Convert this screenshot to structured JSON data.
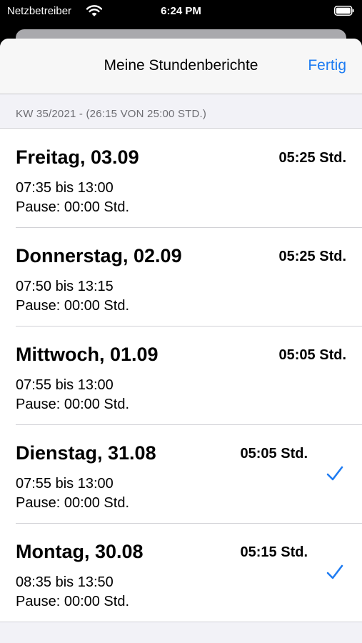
{
  "status_bar": {
    "carrier": "Netzbetreiber",
    "time": "6:24 PM"
  },
  "nav": {
    "title": "Meine Stundenberichte",
    "done_label": "Fertig"
  },
  "section": {
    "header": "KW 35/2021 - (26:15 VON 25:00 STD.)"
  },
  "entries": [
    {
      "day": "Freitag, 03.09",
      "duration": "05:25 Std.",
      "times": "07:35 bis 13:00",
      "pause": "Pause: 00:00 Std.",
      "checked": false
    },
    {
      "day": "Donnerstag, 02.09",
      "duration": "05:25 Std.",
      "times": "07:50 bis 13:15",
      "pause": "Pause: 00:00 Std.",
      "checked": false
    },
    {
      "day": "Mittwoch, 01.09",
      "duration": "05:05 Std.",
      "times": "07:55 bis 13:00",
      "pause": "Pause: 00:00 Std.",
      "checked": false
    },
    {
      "day": "Dienstag, 31.08",
      "duration": "05:05 Std.",
      "times": "07:55 bis 13:00",
      "pause": "Pause: 00:00 Std.",
      "checked": true
    },
    {
      "day": "Montag, 30.08",
      "duration": "05:15 Std.",
      "times": "08:35 bis 13:50",
      "pause": "Pause: 00:00 Std.",
      "checked": true
    }
  ],
  "colors": {
    "accent": "#1f7cf2",
    "background": "#f2f2f7"
  },
  "icons": {
    "wifi": "wifi-icon",
    "battery": "battery-icon",
    "check": "checkmark-icon"
  }
}
